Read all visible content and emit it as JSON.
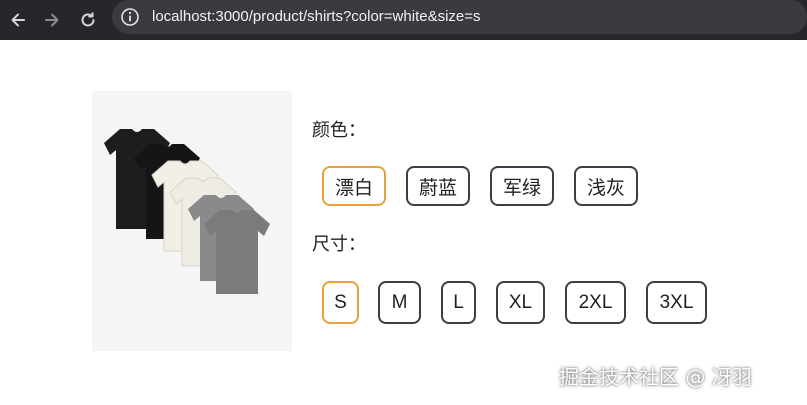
{
  "browser": {
    "url": "localhost:3000/product/shirts?color=white&size=s",
    "icons": {
      "back": "back-arrow-icon",
      "forward": "forward-arrow-icon",
      "reload": "reload-icon",
      "info": "info-icon"
    }
  },
  "product": {
    "image_alt": "T-shirts in black, white and gray",
    "color_label": "颜色：",
    "size_label": "尺寸：",
    "colors": [
      {
        "label": "漂白",
        "selected": true
      },
      {
        "label": "蔚蓝",
        "selected": false
      },
      {
        "label": "军绿",
        "selected": false
      },
      {
        "label": "浅灰",
        "selected": false
      }
    ],
    "sizes": [
      {
        "label": "S",
        "selected": true
      },
      {
        "label": "M",
        "selected": false
      },
      {
        "label": "L",
        "selected": false
      },
      {
        "label": "XL",
        "selected": false
      },
      {
        "label": "2XL",
        "selected": false
      },
      {
        "label": "3XL",
        "selected": false
      }
    ]
  },
  "theme": {
    "selected_border": "#e8a23b",
    "default_border": "#3b3e45",
    "toolbar_bg": "#26272b"
  },
  "watermark": "掘金技术社区 @ 冴羽"
}
